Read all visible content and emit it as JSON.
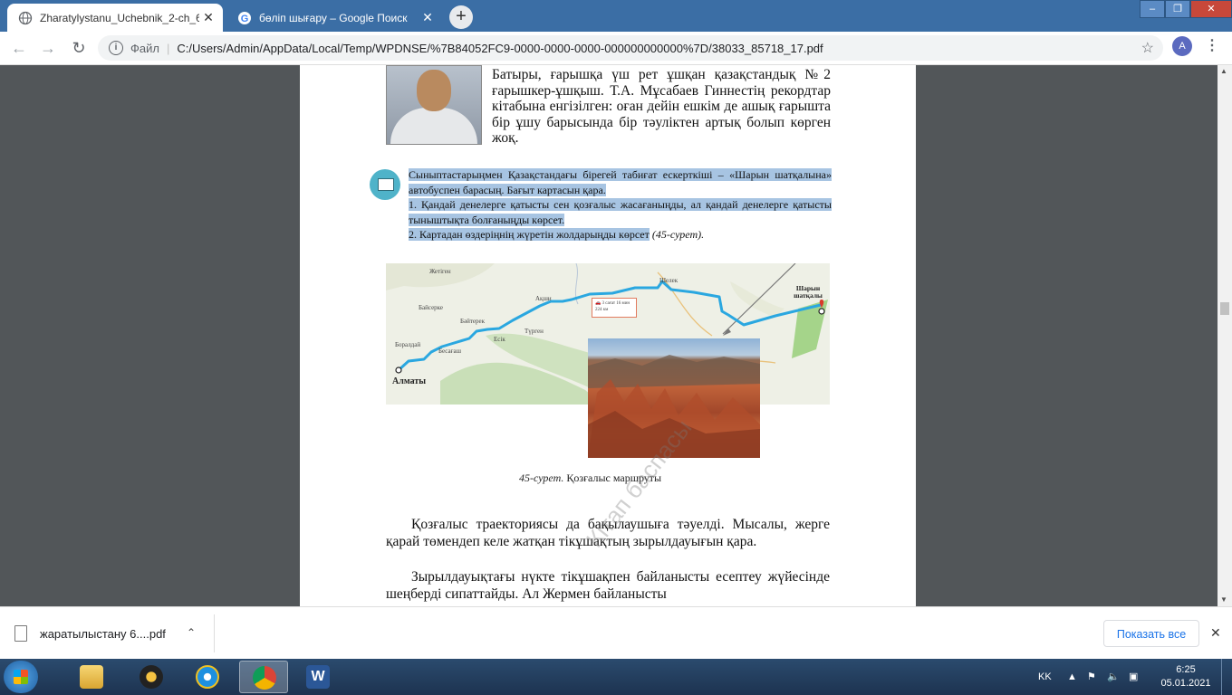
{
  "tabs": [
    {
      "title": "Zharatylystanu_Uchebnik_2-ch_6",
      "active": true,
      "icon": "pdf-icon"
    },
    {
      "title": "бөліп шығару – Google Поиск",
      "active": false,
      "icon": "google-icon"
    }
  ],
  "window_controls": {
    "minimize": "‒",
    "maximize": "❐",
    "close": "✕"
  },
  "toolbar": {
    "scheme": "Файл",
    "url": "C:/Users/Admin/AppData/Local/Temp/WPDNSE/%7B84052FC9-0000-0000-0000-000000000000%7D/38033_85718_17.pdf",
    "avatar_letter": "A"
  },
  "document": {
    "bio_text": "Батыры, ғарышқа үш рет ұшқан қазақстандық №2 ғарышкер-ұшқыш. Т.А. Мұсабаев Гиннестің рекордтар кітабына енгізілген: оған дейін ешкім де ашық ғарышта бір ұшу барысында бір тәуліктен артық болып көрген жоқ.",
    "task_line1": "Сыныптастарыңмен Қазақстандағы бірегей табиғат ескерткіші – «Шарын шатқалына» автобуспен барасың. Бағыт картасын қара.",
    "task_line2": "1. Қандай денелерге қатысты сен қозғалыс жасағаныңды, ал қандай денелерге қатысты тыныштықта болғаныңды көрсет.",
    "task_line3": "2. Картадан өздеріңнің жүретін жолдарыңды көрсет",
    "task_ref": "(45-сурет).",
    "map": {
      "labels": [
        "Жетіген",
        "Байсерке",
        "Бәйтерек",
        "Ақши",
        "Шелек",
        "Түрген",
        "Есік",
        "Боралдай",
        "Бесағаш"
      ],
      "start_city": "Алматы",
      "destination": "Шарын шатқалы",
      "route_time": "3 сағат 16 мин",
      "route_distance": "224 км"
    },
    "caption_num": "45-сурет.",
    "caption_text": " Қозғалыс маршруты",
    "para1": "Қозғалыс траекториясы да бақылаушыға тәуелді. Мысалы, жерге қарай төмендеп келе жатқан тікұшақтың зырылдауығын қара.",
    "para2": "Зырылдауықтағы нүкте тікұшақпен байланысты есептеу жүйесінде шеңберді сипаттайды. Ал Жермен байланысты",
    "watermark": "Кітап баспасы"
  },
  "downloads": {
    "file_name": "жаратылыстану 6....pdf",
    "show_all": "Показать все"
  },
  "taskbar": {
    "lang": "KK",
    "time": "6:25",
    "date": "05.01.2021"
  }
}
